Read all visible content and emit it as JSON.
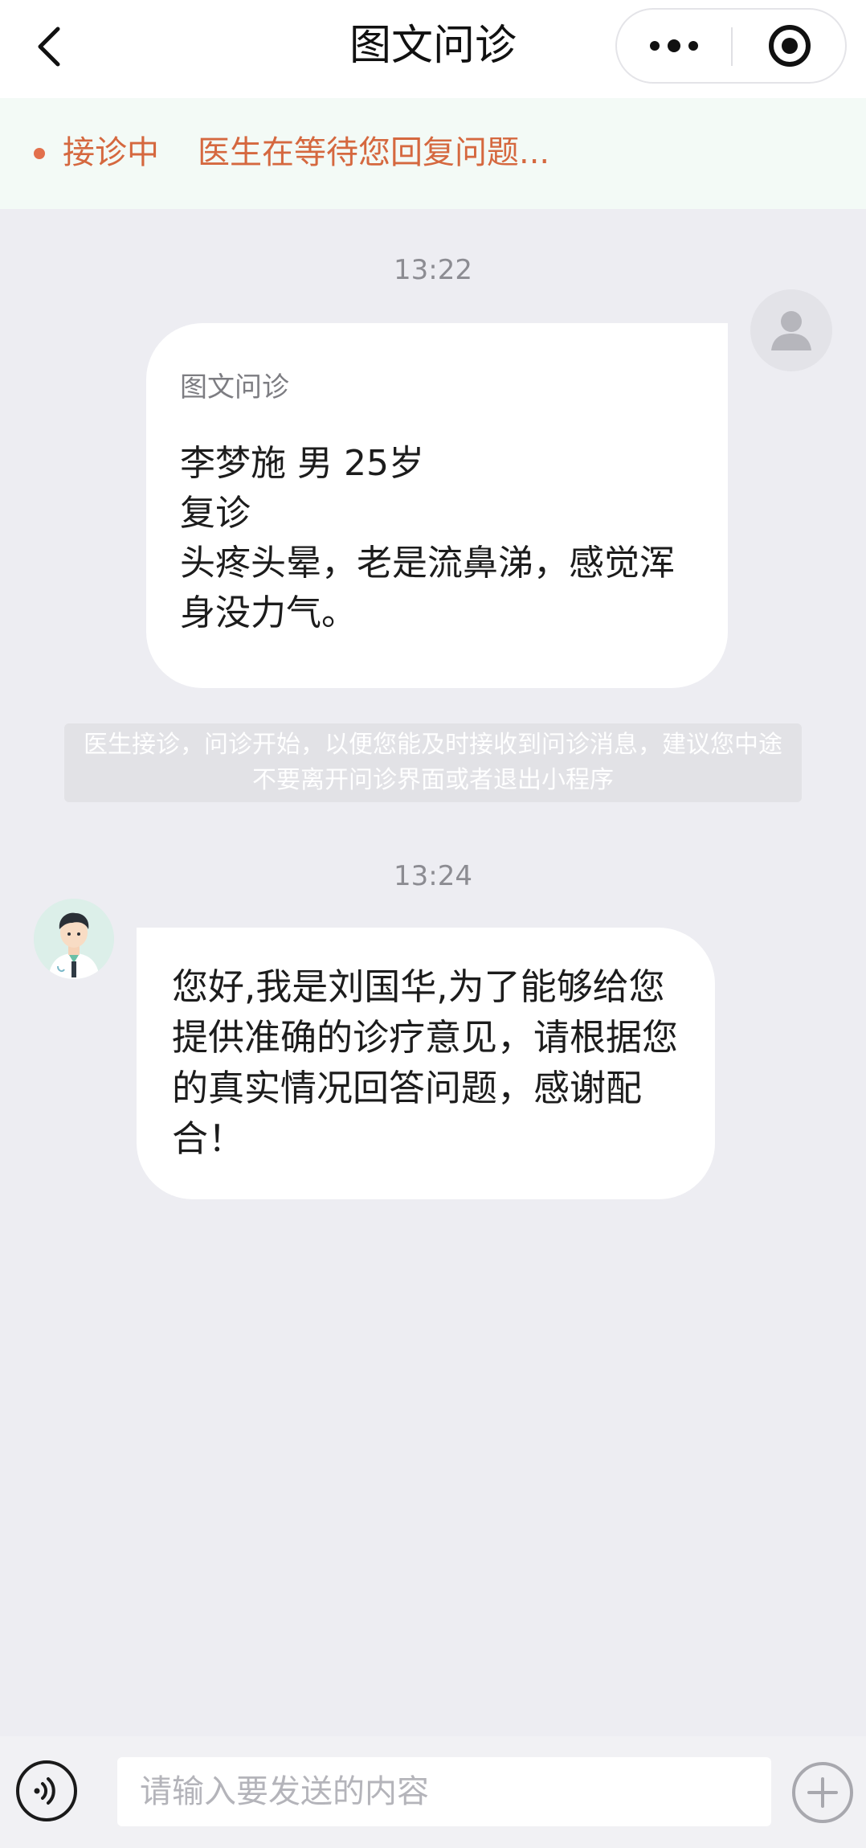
{
  "header": {
    "title": "图文问诊",
    "back_icon": "chevron-left-icon",
    "more_icon": "more-dots-icon",
    "close_icon": "target-circle-icon"
  },
  "status": {
    "label": "接诊中",
    "message": "医生在等待您回复问题...",
    "color": "#d5683f"
  },
  "chat": {
    "messages": [
      {
        "timestamp": "13:22",
        "sender": "user",
        "card_label": "图文问诊",
        "lines": [
          "李梦施 男 25岁",
          "复诊",
          "头疼头晕，老是流鼻涕，感觉浑身没力气。"
        ]
      },
      {
        "system_notice": "医生接诊，问诊开始，以便您能及时接收到问诊消息，建议您中途不要离开问诊界面或者退出小程序"
      },
      {
        "timestamp": "13:24",
        "sender": "doctor",
        "text": "您好,我是刘国华,为了能够给您提供准确的诊疗意见，请根据您的真实情况回答问题，感谢配合！"
      }
    ]
  },
  "input": {
    "placeholder": "请输入要发送的内容",
    "voice_icon": "voice-icon",
    "add_icon": "plus-circle-icon"
  }
}
